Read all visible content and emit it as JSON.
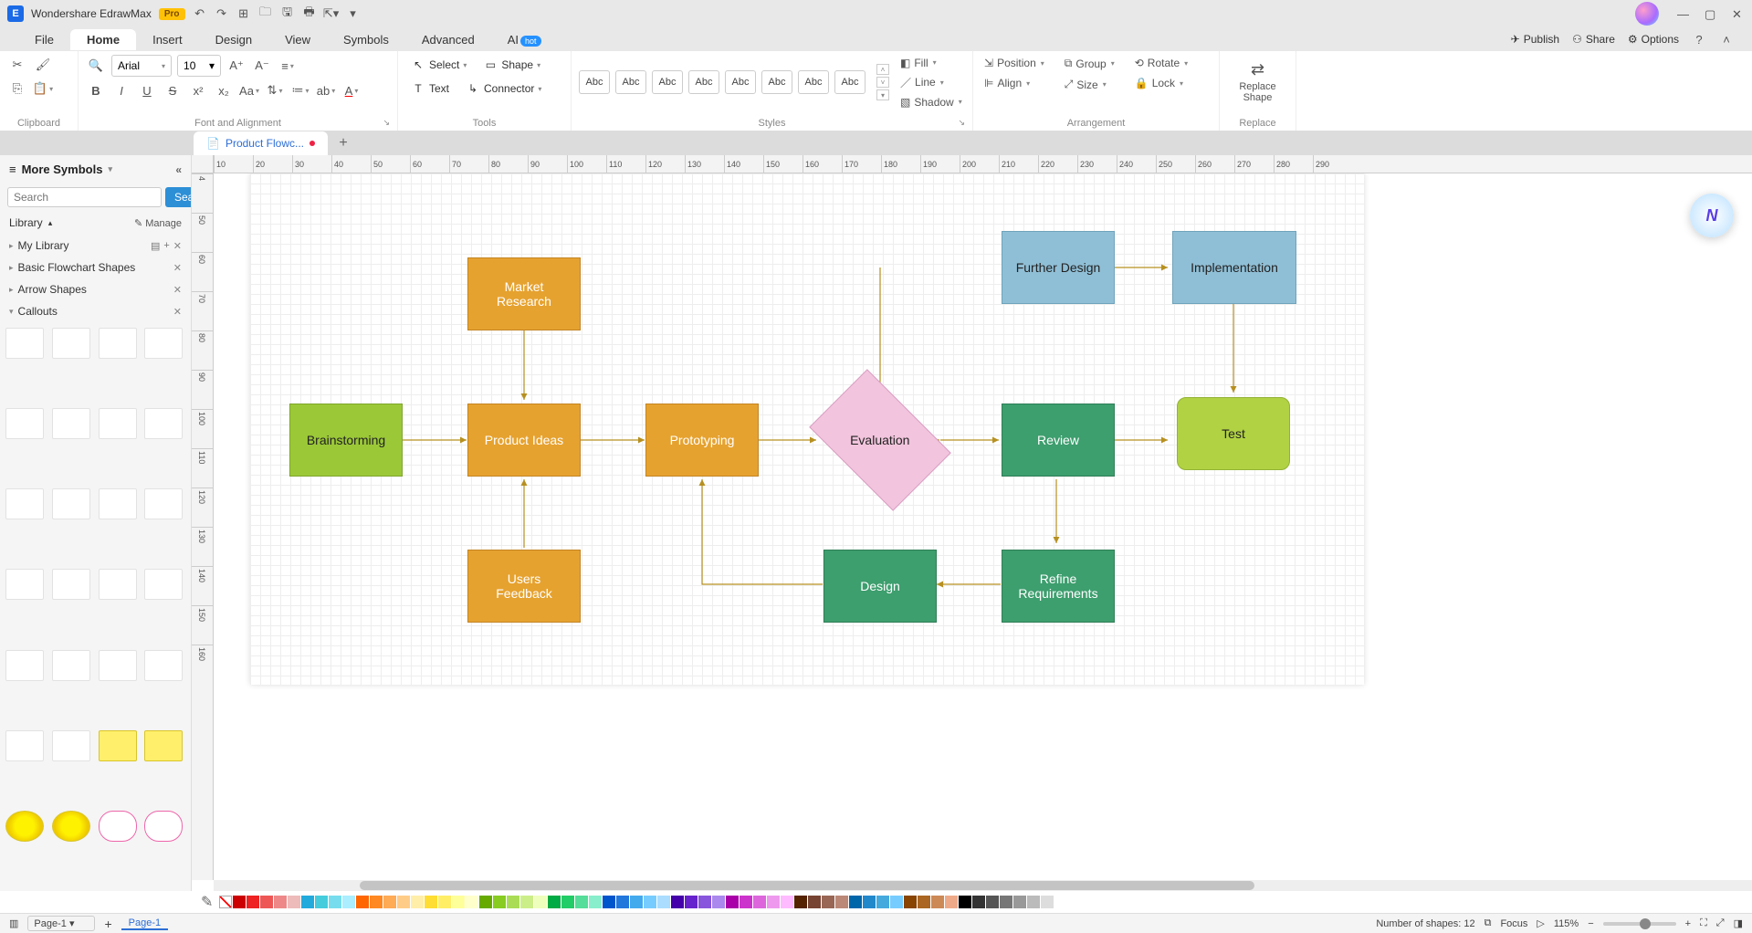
{
  "app": {
    "title": "Wondershare EdrawMax",
    "pro": "Pro"
  },
  "menus": {
    "items": [
      "File",
      "Home",
      "Insert",
      "Design",
      "View",
      "Symbols",
      "Advanced",
      "AI"
    ],
    "active": 1,
    "hot": "hot",
    "right": {
      "publish": "Publish",
      "share": "Share",
      "options": "Options"
    }
  },
  "ribbon": {
    "font_name": "Arial",
    "font_size": "10",
    "clipboard": "Clipboard",
    "font_align": "Font and Alignment",
    "tools": "Tools",
    "styles": "Styles",
    "arrangement": "Arrangement",
    "replace": "Replace",
    "select": "Select",
    "shape": "Shape",
    "text": "Text",
    "connector": "Connector",
    "fill": "Fill",
    "line": "Line",
    "shadow": "Shadow",
    "position": "Position",
    "group": "Group",
    "rotate": "Rotate",
    "align": "Align",
    "size": "Size",
    "lock": "Lock",
    "replace_shape": "Replace\nShape",
    "style_label": "Abc"
  },
  "tabs": {
    "doc": "Product Flowc..."
  },
  "side": {
    "title": "More Symbols",
    "search_placeholder": "Search",
    "search_btn": "Search",
    "library": "Library",
    "manage": "Manage",
    "cats": [
      "My Library",
      "Basic Flowchart Shapes",
      "Arrow Shapes",
      "Callouts"
    ]
  },
  "ruler_h": [
    "10",
    "20",
    "30",
    "40",
    "50",
    "60",
    "70",
    "80",
    "90",
    "100",
    "110",
    "120",
    "130",
    "140",
    "150",
    "160",
    "170",
    "180",
    "190",
    "200",
    "210",
    "220",
    "230",
    "240",
    "250",
    "260",
    "270",
    "280",
    "290"
  ],
  "ruler_v": [
    "4",
    "50",
    "60",
    "70",
    "80",
    "90",
    "100",
    "110",
    "120",
    "130",
    "140",
    "150",
    "160"
  ],
  "nodes": {
    "brainstorm": "Brainstorming",
    "market": "Market\nResearch",
    "ideas": "Product Ideas",
    "feedback": "Users\nFeedback",
    "proto": "Prototyping",
    "eval": "Evaluation",
    "further": "Further Design",
    "review": "Review",
    "refine": "Refine\nRequirements",
    "design": "Design",
    "impl": "Implementation",
    "test": "Test"
  },
  "status": {
    "page_sel": "Page-1",
    "page_tab": "Page-1",
    "shapes": "Number of shapes: 12",
    "focus": "Focus",
    "zoom": "115%"
  }
}
